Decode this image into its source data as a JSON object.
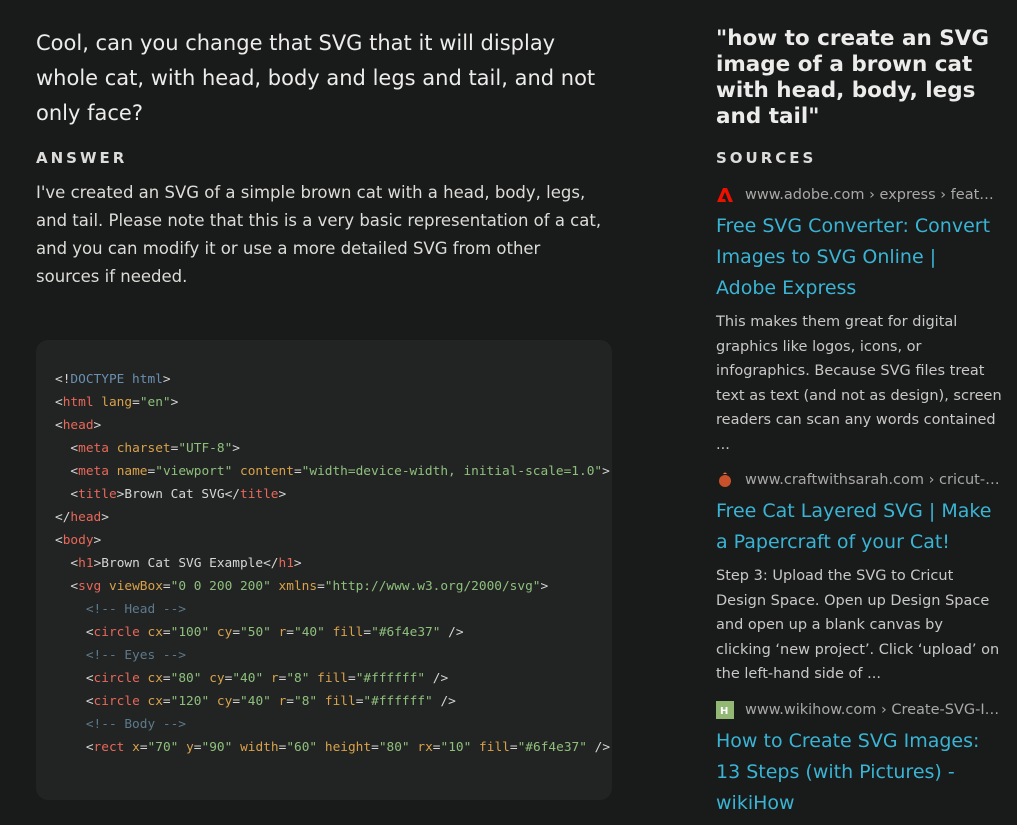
{
  "question": "Cool, can you change that SVG that it will display whole cat, with head, body and legs and tail, and not only face?",
  "answer": {
    "heading": "ANSWER",
    "text": "I've created an SVG of a simple brown cat with a head, body, legs, and tail. Please note that this is a very basic representation of a cat, and you can modify it or use a more detailed SVG from other sources if needed."
  },
  "code_lines": [
    "<!DOCTYPE html>",
    "<html lang=\"en\">",
    "<head>",
    "  <meta charset=\"UTF-8\">",
    "  <meta name=\"viewport\" content=\"width=device-width, initial-scale=1.0\">",
    "  <title>Brown Cat SVG</title>",
    "</head>",
    "<body>",
    "  <h1>Brown Cat SVG Example</h1>",
    "  <svg viewBox=\"0 0 200 200\" xmlns=\"http://www.w3.org/2000/svg\">",
    "    <!-- Head -->",
    "    <circle cx=\"100\" cy=\"50\" r=\"40\" fill=\"#6f4e37\" />",
    "    <!-- Eyes -->",
    "    <circle cx=\"80\" cy=\"40\" r=\"8\" fill=\"#ffffff\" />",
    "    <circle cx=\"120\" cy=\"40\" r=\"8\" fill=\"#ffffff\" />",
    "    <!-- Body -->",
    "    <rect x=\"70\" y=\"90\" width=\"60\" height=\"80\" rx=\"10\" fill=\"#6f4e37\" />"
  ],
  "search_query": "\"how to create an SVG image of a brown cat with head, body, legs and tail\"",
  "sources_heading": "SOURCES",
  "sources": [
    {
      "favicon": "adobe-icon",
      "favicon_color": "#eb1000",
      "domain": "www.adobe.com › express › feature › image › convert › svg",
      "title": "Free SVG Converter: Convert Images to SVG Online | Adobe Express",
      "snippet": "This makes them great for digital graphics like logos, icons, or infographics. Because SVG files treat text as text (and not as design), screen readers can scan any words contained ..."
    },
    {
      "favicon": "craftwithsarah-icon",
      "favicon_color": "#c8502a",
      "domain": "www.craftwithsarah.com › cricut-cat-layered-svg",
      "title": "Free Cat Layered SVG | Make a Papercraft of your Cat!",
      "snippet": "Step 3: Upload the SVG to Cricut Design Space. Open up Design Space and open up a blank canvas by clicking ‘new project’. Click ‘upload’ on the left-hand side of ..."
    },
    {
      "favicon": "wikihow-icon",
      "favicon_color": "#93b874",
      "domain": "www.wikihow.com › Create-SVG-Images",
      "title": "How to Create SVG Images: 13 Steps (with Pictures) - wikiHow",
      "snippet": ""
    }
  ]
}
